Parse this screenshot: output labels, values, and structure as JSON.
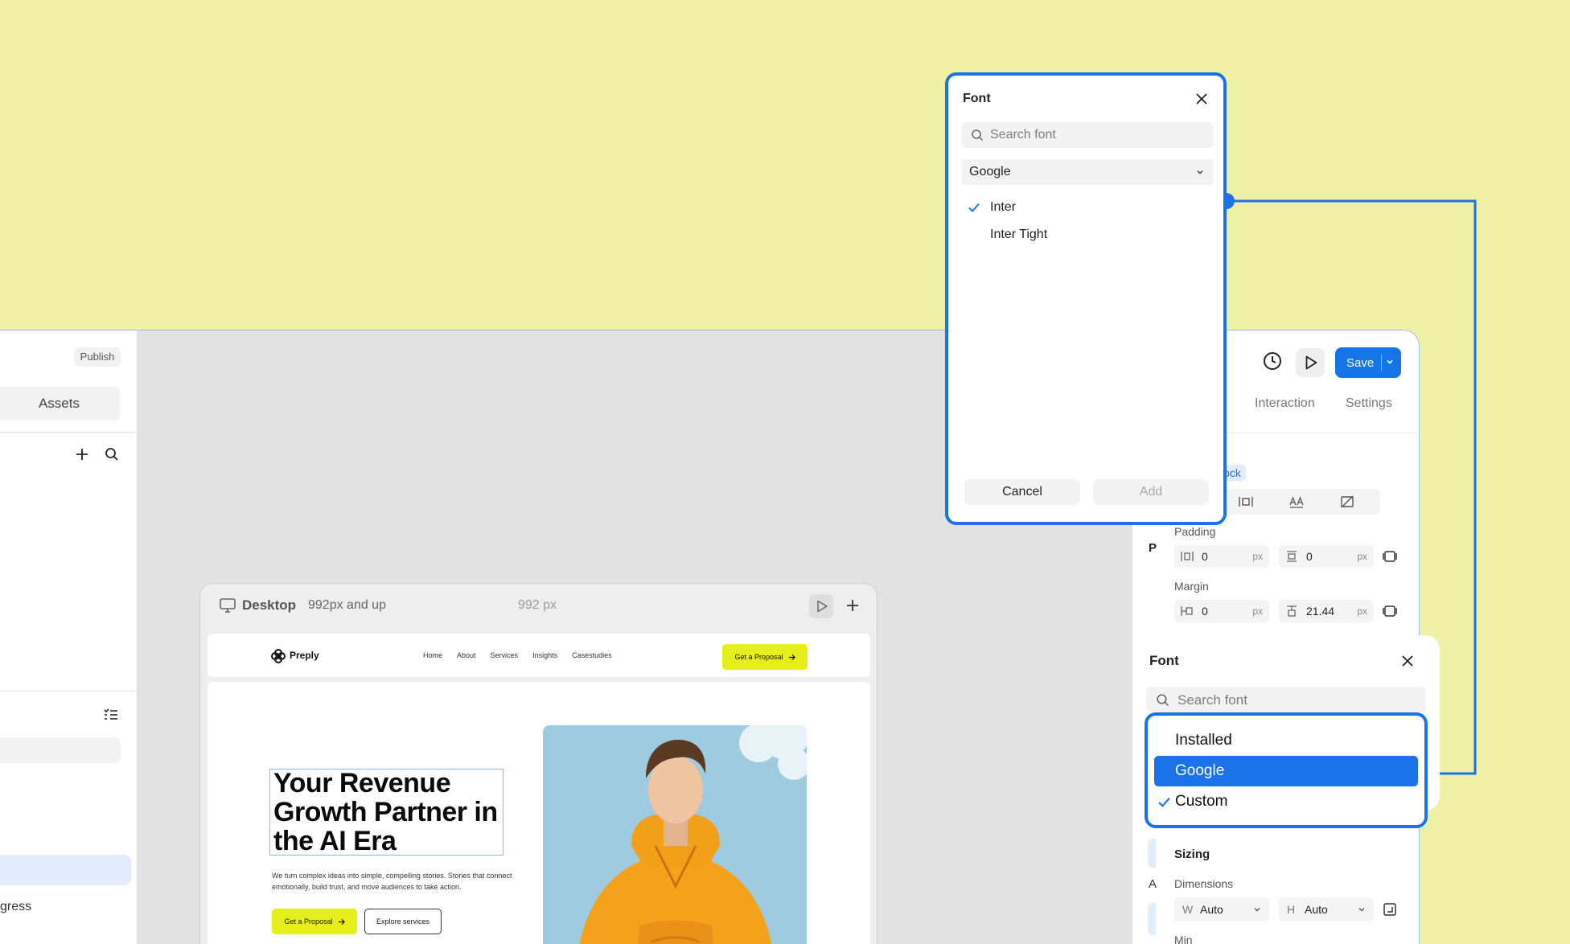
{
  "left_panel": {
    "publish_label": "Publish",
    "assets_label": "Assets",
    "progress_text": "gress"
  },
  "preview": {
    "device_label": "Desktop",
    "breakpoint_label": "992px and up",
    "width_label": "992 px",
    "site": {
      "brand": "Preply",
      "nav_links": [
        "Home",
        "About",
        "Services",
        "Insights",
        "Casestudies"
      ],
      "nav_cta": "Get a Proposal",
      "hero_title": "Your Revenue Growth Partner in the AI Era",
      "hero_subtitle": "We turn complex ideas into simple, compelling stories. Stories that connect emotionally, build trust, and move audiences to take action.",
      "primary_cta": "Get a Proposal",
      "secondary_cta": "Explore services"
    }
  },
  "right_panel": {
    "save_label": "Save",
    "tabs": [
      "Interaction",
      "Settings"
    ],
    "block_badge": "lock",
    "p_letter": "P",
    "padding_label": "Padding",
    "padding_values": [
      "0",
      "0"
    ],
    "margin_label": "Margin",
    "margin_values": [
      "0",
      "21.44"
    ],
    "unit": "px",
    "sizing_title": "Sizing",
    "a_letter": "A",
    "dimensions_label": "Dimensions",
    "width_prefix": "W",
    "width_value": "Auto",
    "height_prefix": "H",
    "height_value": "Auto",
    "min_label": "Min"
  },
  "font_popup": {
    "title": "Font",
    "search_placeholder": "Search font",
    "source_value": "Google",
    "fonts": [
      {
        "name": "Inter",
        "selected": true
      },
      {
        "name": "Inter Tight",
        "selected": false
      }
    ],
    "cancel_label": "Cancel",
    "add_label": "Add"
  },
  "font_panel_lower": {
    "title": "Font",
    "search_placeholder": "Search font",
    "options": [
      {
        "label": "Installed",
        "highlighted": false,
        "checked": false
      },
      {
        "label": "Google",
        "highlighted": true,
        "checked": false
      },
      {
        "label": "Custom",
        "highlighted": false,
        "checked": true
      }
    ]
  },
  "colors": {
    "background": "#eff1a6",
    "accent_blue": "#1a73e8",
    "cta_yellow": "#e6ef1a"
  }
}
